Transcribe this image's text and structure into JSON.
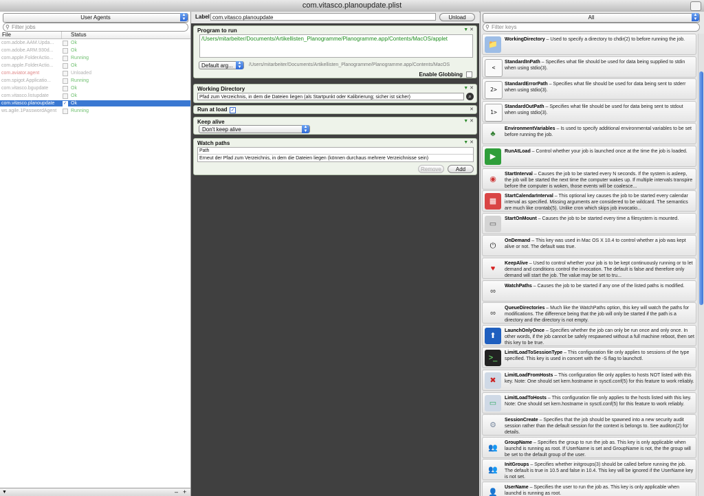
{
  "window": {
    "title": "com.vitasco.planoupdate.plist"
  },
  "left": {
    "selector": "User Agents",
    "search_placeholder": "Filter jobs",
    "col_file": "File",
    "col_status": "Status",
    "jobs": [
      {
        "name": "com.adobe.AAM.Upda...",
        "status": "Ok",
        "status_color": "#6fbf6f"
      },
      {
        "name": "com.adobe.ARM.930d...",
        "status": "Ok",
        "status_color": "#6fbf6f"
      },
      {
        "name": "com.apple.FolderActio...",
        "status": "Running",
        "status_color": "#6fbf6f"
      },
      {
        "name": "com.apple.FolderActio...",
        "status": "Ok",
        "status_color": "#6fbf6f"
      },
      {
        "name": "com.aviator.agent",
        "status": "Unloaded",
        "status_color": "#b0b0b0",
        "name_color": "#e08a8a"
      },
      {
        "name": "com.spigot.Applicatio...",
        "status": "Running",
        "status_color": "#6fbf6f"
      },
      {
        "name": "com.vitasco.bgupdate",
        "status": "Ok",
        "status_color": "#6fbf6f"
      },
      {
        "name": "com.vitasco.listupdate",
        "status": "Ok",
        "status_color": "#6fbf6f"
      },
      {
        "name": "com.vitasco.planoupdate",
        "status": "Ok",
        "selected": true
      },
      {
        "name": "ws.agile.1PasswordAgent",
        "status": "Running",
        "status_color": "#6fbf6f"
      }
    ],
    "bottom_add": "+",
    "bottom_remove": "–"
  },
  "mid": {
    "label_caption": "Label",
    "label_value": "com.vitasco.planoupdate",
    "unload_label": "Unload",
    "program": {
      "title": "Program to run",
      "path": "/Users/mitarbeiter/Documents/Artikellisten_Planogramme/Planogramme.app/Contents/MacOS/applet",
      "default_args_label": "Default arg...",
      "args_path": "/Users/mitarbeiter/Documents/Artikellisten_Planogramme/Planogramme.app/Contents/MacOS",
      "globbing_label": "Enable Globbing"
    },
    "workdir": {
      "title": "Working Directory",
      "value": "Pfad zum Verzeichnis, in dem die Dateien liegen (als Startpunkt oder Kalibrierung; sicher ist sicher)"
    },
    "runatload": {
      "title": "Run at load"
    },
    "keepalive": {
      "title": "Keep alive",
      "value": "Don't keep alive"
    },
    "watchpaths": {
      "title": "Watch paths",
      "col": "Path",
      "row": "Erneut der Pfad zum Verzeichnis, in dem die Dateien liegen (können durchaus mehrere Verzeichnisse sein)",
      "remove_label": "Remove",
      "add_label": "Add"
    }
  },
  "right": {
    "filter_select": "All",
    "search_placeholder": "Filter keys",
    "keys": [
      {
        "name": "WorkingDirectory",
        "desc": " – Used to specify a directory to chdir(2) to before running the job.",
        "icon": "folder-icon"
      },
      {
        "name": "StandardInPath",
        "desc": " – Specifies what file should be used for data being supplied to stdin when using stdio(3).",
        "icon": "stdin-icon",
        "glyph": "<"
      },
      {
        "name": "StandardErrorPath",
        "desc": " – Specifies what file should be used for data being sent to stderr when using stdio(3).",
        "icon": "stderr-icon",
        "glyph": "2>"
      },
      {
        "name": "StandardOutPath",
        "desc": " – Specifies what file should be used for data being sent to stdout when using stdio(3).",
        "icon": "stdout-icon",
        "glyph": "1>"
      },
      {
        "name": "EnvironmentVariables",
        "desc": " – Is used to specify additional environmental variables to be set before running the job.",
        "icon": "tree-icon"
      },
      {
        "name": "RunAtLoad",
        "desc": " – Control whether your job is launched once at the time the job is loaded.",
        "icon": "play-icon"
      },
      {
        "name": "StartInterval",
        "desc": " – Causes the job to be started every N seconds.  If the system is asleep, the job will be started the next time the computer wakes up.  If multiple intervals transpire before the computer is woken, those events will be coalesce...",
        "icon": "stopwatch-icon"
      },
      {
        "name": "StartCalendarInterval",
        "desc": " – This optional key causes the job to be started every calendar interval as specified. Missing arguments are considered to be wildcard. The semantics are much like crontab(5).  Unlike cron which skips job invocatio...",
        "icon": "calendar-icon"
      },
      {
        "name": "StartOnMount",
        "desc": " – Causes the job to be started every time a filesystem is mounted.",
        "icon": "disk-icon"
      },
      {
        "name": "OnDemand",
        "desc": " – This key was used in Mac OS X 10.4 to control whether a job was kept alive or not. The default was true.",
        "icon": "plug-icon"
      },
      {
        "name": "KeepAlive",
        "desc": " – Used to control whether your job is to be kept continuously running or to let demand and conditions control the invocation.  The default is false and therefore only demand will start the job.  The value may be set to tru...",
        "icon": "heart-icon"
      },
      {
        "name": "WatchPaths",
        "desc": " – Causes the job to be started if any one of the listed paths is modified.",
        "icon": "binoculars-icon"
      },
      {
        "name": "QueueDirectories",
        "desc": " – Much like the WatchPaths option, this key will watch the paths for modifications. The difference being that the job will only be started if the path is a directory and the directory is not empty.",
        "icon": "binoculars-icon"
      },
      {
        "name": "LaunchOnlyOnce",
        "desc": " – Specifies whether the job can only be run once and only once.  In other words, if the job cannot be safely respawned without a full machine reboot, then set this key to be true.",
        "icon": "up-arrow-icon"
      },
      {
        "name": "LimitLoadToSessionType",
        "desc": " – This configuration file only applies to sessions of the type specified. This key is used in concert with the -S flag to launchctl.",
        "icon": "terminal-icon"
      },
      {
        "name": "LimitLoadFromHosts",
        "desc": " – This configuration file only applies to hosts NOT listed with this key. Note: One should set kern.hostname in sysctl.conf(5) for this feature to work reliably.",
        "icon": "monitor-x-icon"
      },
      {
        "name": "LimitLoadToHosts",
        "desc": " – This configuration file only applies to the hosts listed with this key. Note: One should set kern.hostname in sysctl.conf(5) for this feature to work reliably.",
        "icon": "monitor-icon"
      },
      {
        "name": "SessionCreate",
        "desc": " – Specifies that the job should be spawned into a new security audit session rather than the default session for the context is belongs to. See auditon(2) for details.",
        "icon": "gear-icon"
      },
      {
        "name": "GroupName",
        "desc": " – Specifies the group to run the job as. This key is only applicable when launchd is running as root. If UserName is set and GroupName is not, the the group will be set to the default group of the user.",
        "icon": "group-icon"
      },
      {
        "name": "InitGroups",
        "desc": " – Specifies whether initgroups(3) should be called before running the job.  The default is true in 10.5 and false in 10.4. This key will be ignored if the UserName key is not set.",
        "icon": "group-icon"
      },
      {
        "name": "UserName",
        "desc": " – Specifies the user to run the job as. This key is only applicable when launchd is running as root.",
        "icon": "user-icon"
      }
    ]
  }
}
